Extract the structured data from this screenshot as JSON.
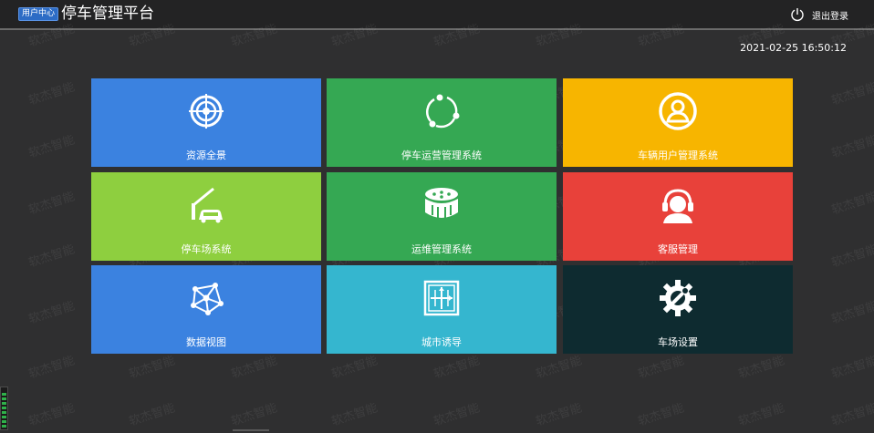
{
  "header": {
    "badge": "用户中心",
    "title": "停车管理平台",
    "logout_label": "退出登录"
  },
  "datetime": "2021-02-25 16:50:12",
  "watermark_text": "软杰智能",
  "tiles": [
    {
      "label": "资源全景",
      "icon": "target-icon",
      "color": "#3b82e0"
    },
    {
      "label": "停车运营管理系统",
      "icon": "network-cycle-icon",
      "color": "#35a853"
    },
    {
      "label": "车辆用户管理系统",
      "icon": "user-icon",
      "color": "#f7b500"
    },
    {
      "label": "停车场系统",
      "icon": "parking-barrier-icon",
      "color": "#8ecf3f"
    },
    {
      "label": "运维管理系统",
      "icon": "server-disk-icon",
      "color": "#35a853"
    },
    {
      "label": "客服管理",
      "icon": "customer-service-icon",
      "color": "#e8413a"
    },
    {
      "label": "数据视图",
      "icon": "data-network-icon",
      "color": "#3b82e0"
    },
    {
      "label": "城市诱导",
      "icon": "city-guide-icon",
      "color": "#35b6cf"
    },
    {
      "label": "车场设置",
      "icon": "gear-wrench-icon",
      "color": "#0e2b30"
    }
  ]
}
